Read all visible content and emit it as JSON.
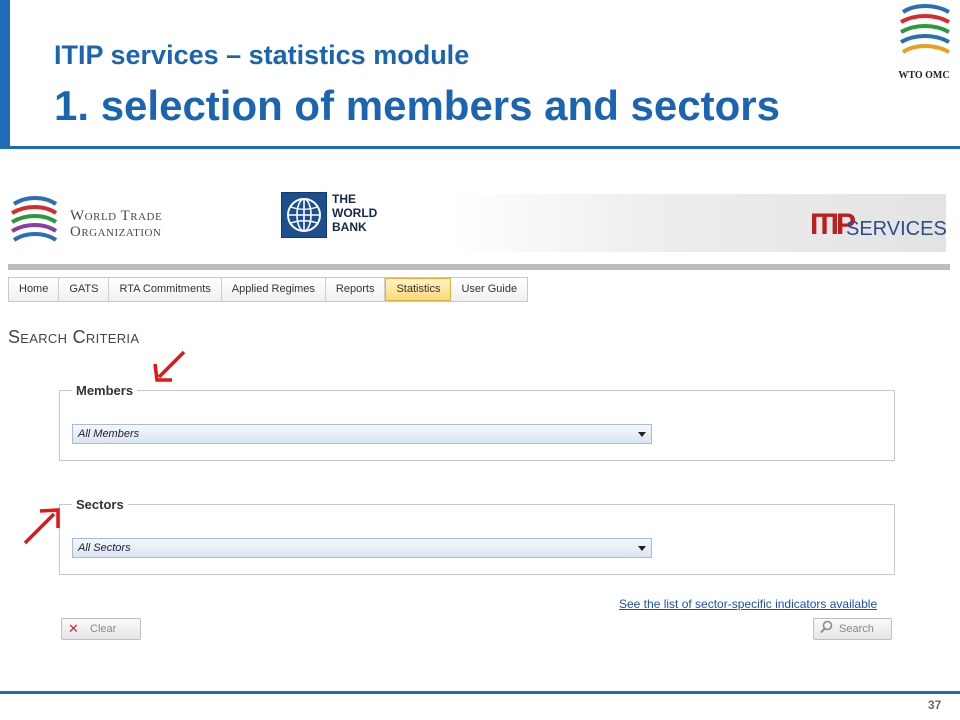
{
  "slide": {
    "title": "ITIP services – statistics module",
    "heading": "1. selection of members and sectors",
    "corner_logo_text": "WTO OMC",
    "page_number": "37",
    "accent_color": "#1f6cb6",
    "annotation_color": "#e01818"
  },
  "header": {
    "wto_logo_line1": "World Trade",
    "wto_logo_line2": "Organization",
    "wb_logo_line1": "THE",
    "wb_logo_line2": "WORLD",
    "wb_logo_line3": "BANK",
    "itip_mark": "ITIP",
    "itip_word": "SERVICES"
  },
  "nav": {
    "items": [
      {
        "label": "Home"
      },
      {
        "label": "GATS"
      },
      {
        "label": "RTA Commitments"
      },
      {
        "label": "Applied Regimes"
      },
      {
        "label": "Reports"
      },
      {
        "label": "Statistics"
      },
      {
        "label": "User Guide"
      }
    ],
    "active": "Statistics"
  },
  "search": {
    "title": "Search Criteria",
    "members": {
      "legend": "Members",
      "selected": "All Members"
    },
    "sectors": {
      "legend": "Sectors",
      "selected": "All Sectors"
    },
    "indicators_link": "See the list of sector-specific indicators available",
    "clear_label": "Clear",
    "search_label": "Search"
  },
  "icons": {
    "clear": "close-icon",
    "search": "magnifier-icon",
    "dropdown": "chevron-down-icon"
  }
}
